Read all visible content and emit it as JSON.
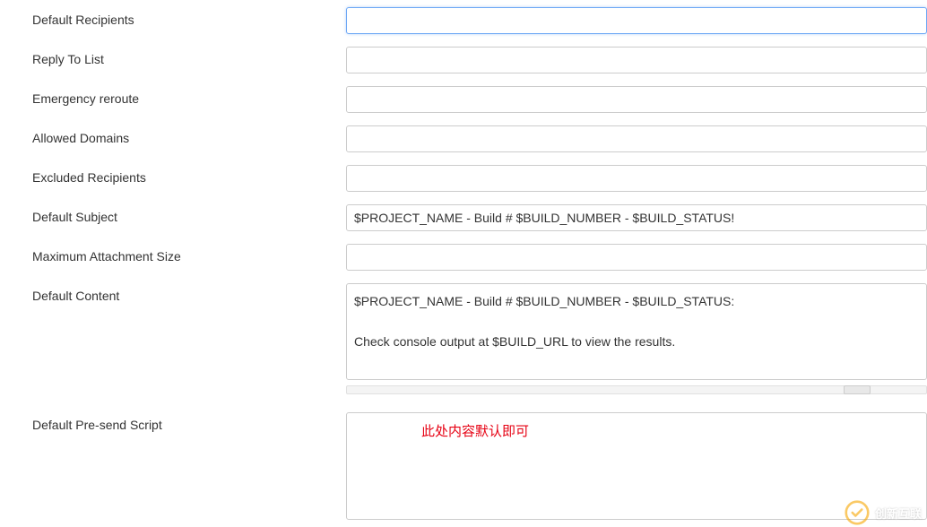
{
  "fields": {
    "defaultRecipients": {
      "label": "Default Recipients",
      "value": ""
    },
    "replyToList": {
      "label": "Reply To List",
      "value": ""
    },
    "emergencyReroute": {
      "label": "Emergency reroute",
      "value": ""
    },
    "allowedDomains": {
      "label": "Allowed Domains",
      "value": ""
    },
    "excludedRecipients": {
      "label": "Excluded Recipients",
      "value": ""
    },
    "defaultSubject": {
      "label": "Default Subject",
      "value": "$PROJECT_NAME - Build # $BUILD_NUMBER - $BUILD_STATUS!"
    },
    "maxAttachmentSize": {
      "label": "Maximum Attachment Size",
      "value": ""
    },
    "defaultContent": {
      "label": "Default Content",
      "value": "$PROJECT_NAME - Build # $BUILD_NUMBER - $BUILD_STATUS:\n\nCheck console output at $BUILD_URL to view the results."
    },
    "defaultPresendScript": {
      "label": "Default Pre-send Script",
      "value": ""
    }
  },
  "annotation": "此处内容默认即可",
  "watermark": "创新互联"
}
